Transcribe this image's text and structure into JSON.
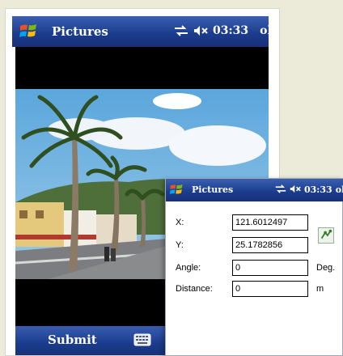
{
  "back": {
    "title": "Pictures",
    "time": "03:33",
    "ok": "ok",
    "submit": "Submit"
  },
  "front": {
    "title": "Pictures",
    "time": "03:33",
    "ok": "ok",
    "fields": {
      "x_label": "X:",
      "x_value": "121.6012497",
      "y_label": "Y:",
      "y_value": "25.1782856",
      "angle_label": "Angle:",
      "angle_value": "0",
      "angle_unit": "Deg.",
      "distance_label": "Distance:",
      "distance_value": "0",
      "distance_unit": "m"
    }
  },
  "icons": {
    "start": "windows-flag-icon",
    "connectivity": "connectivity-icon",
    "volume": "volume-muted-icon",
    "keyboard": "keyboard-icon",
    "gps": "gps-locate-icon"
  }
}
